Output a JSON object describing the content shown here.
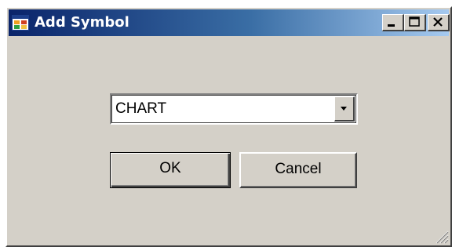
{
  "window": {
    "title": "Add Symbol",
    "caption_buttons": {
      "minimize": "minimize-icon",
      "maximize": "maximize-icon",
      "close": "close-icon"
    }
  },
  "form": {
    "symbol_select": {
      "value": "CHART"
    },
    "ok_label": "OK",
    "cancel_label": "Cancel"
  },
  "colors": {
    "dialog_face": "#d4d0c8",
    "title_gradient_start": "#0a246a",
    "title_gradient_end": "#a6caf0",
    "title_text": "#ffffff"
  }
}
